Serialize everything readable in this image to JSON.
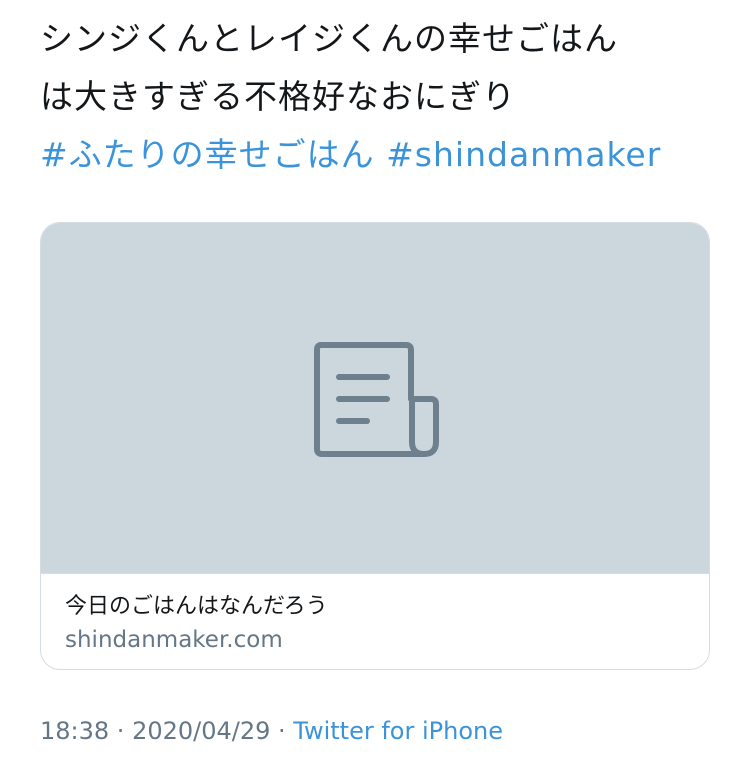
{
  "tweet": {
    "lines": [
      "シンジくんとレイジくんの幸せごはん",
      "は大きすぎる不格好なおにぎり"
    ],
    "hashtags": [
      "#ふたりの幸せごはん",
      "#shindanmaker"
    ]
  },
  "card": {
    "placeholder_icon": "article-document-icon",
    "title": "今日のごはんはなんだろう",
    "domain": "shindanmaker.com"
  },
  "meta": {
    "time": "18:38",
    "separator": " · ",
    "date": "2020/04/29",
    "source": "Twitter for iPhone"
  },
  "colors": {
    "link": "#3b94d9",
    "text": "#14171a",
    "secondary": "#657786",
    "card_media_bg": "#ccd6dd",
    "icon": "#6e7f8d",
    "border": "#d5dce2"
  }
}
